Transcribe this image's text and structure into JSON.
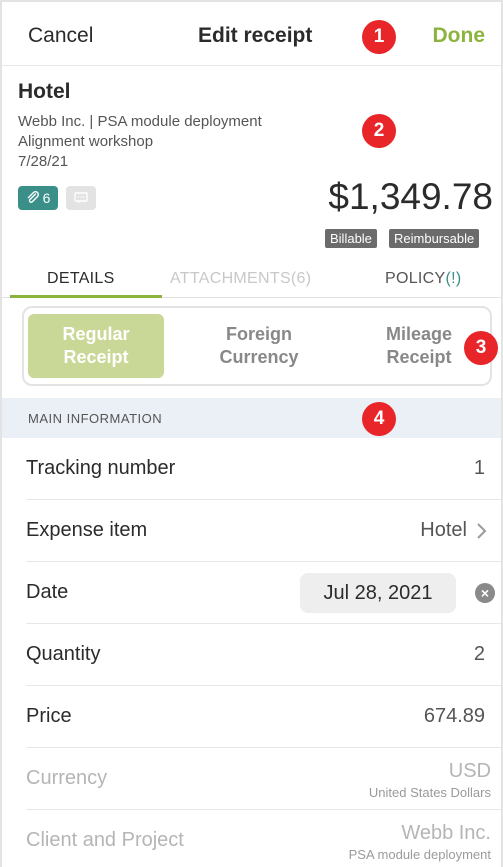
{
  "header": {
    "cancel_label": "Cancel",
    "title": "Edit receipt",
    "done_label": "Done"
  },
  "callouts": [
    "1",
    "2",
    "3",
    "4"
  ],
  "receipt": {
    "type": "Hotel",
    "client_project": "Webb Inc. | PSA module deployment",
    "description": "Alignment workshop",
    "date": "7/28/21",
    "attachments_count": "6",
    "amount": "$1,349.78",
    "flags": [
      "Billable",
      "Reimbursable"
    ]
  },
  "tabs": {
    "details": "DETAILS",
    "attachments": "ATTACHMENTS(6)",
    "policy": "POLICY",
    "policy_flag": "(!)"
  },
  "receipt_kind": {
    "options": [
      {
        "line1": "Regular",
        "line2": "Receipt"
      },
      {
        "line1": "Foreign",
        "line2": "Currency"
      },
      {
        "line1": "Mileage",
        "line2": "Receipt"
      }
    ],
    "selected": "Regular Receipt"
  },
  "section": {
    "title": "MAIN INFORMATION"
  },
  "fields": {
    "tracking_number": {
      "label": "Tracking number",
      "value": "1"
    },
    "expense_item": {
      "label": "Expense item",
      "value": "Hotel"
    },
    "date": {
      "label": "Date",
      "value": "Jul 28, 2021"
    },
    "quantity": {
      "label": "Quantity",
      "value": "2"
    },
    "price": {
      "label": "Price",
      "value": "674.89"
    },
    "currency": {
      "label": "Currency",
      "value": "USD",
      "sub": "United States Dollars"
    },
    "client_project": {
      "label": "Client and Project",
      "value": "Webb Inc.",
      "sub": "PSA module deployment"
    }
  },
  "colors": {
    "accent": "#8db33f",
    "segment_active": "#c9d896",
    "attach_chip": "#3a8f89",
    "callout": "#e8262a",
    "section_bg": "#eaf0f6"
  }
}
